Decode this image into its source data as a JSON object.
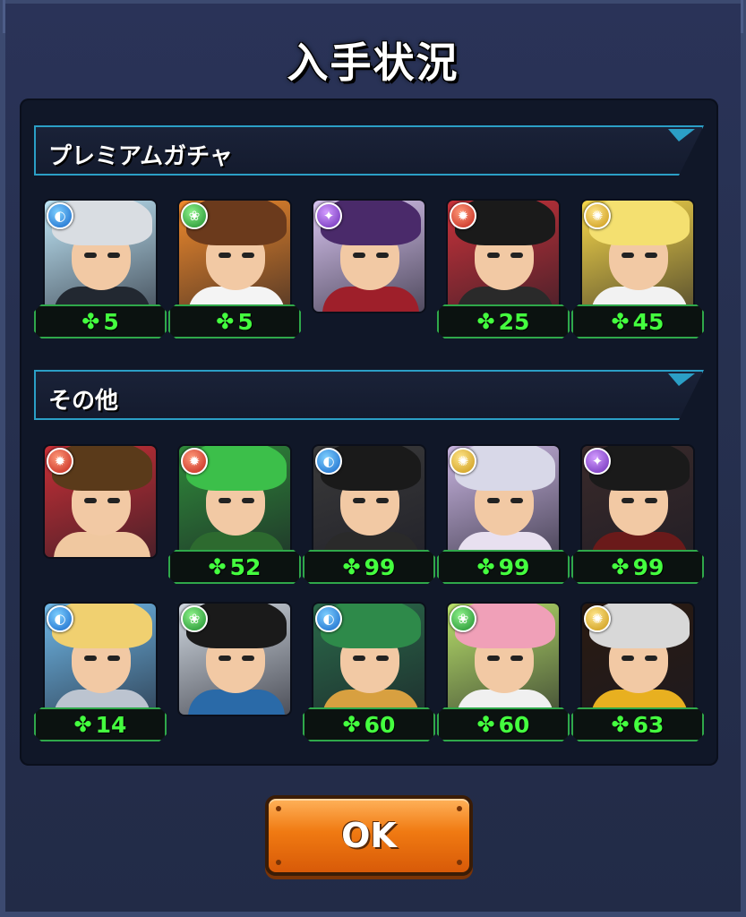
{
  "dialog": {
    "title": "入手状況"
  },
  "sections": [
    {
      "label": "プレミアムガチャ",
      "items": [
        {
          "attribute": "water",
          "count": "5",
          "colors": {
            "bg": "#bfe6f7",
            "hair": "#d9dde2",
            "body": "#222831"
          }
        },
        {
          "attribute": "wood",
          "count": "5",
          "colors": {
            "bg": "#f08a2c",
            "hair": "#6b3a1c",
            "body": "#f4f4f4"
          }
        },
        {
          "attribute": "dark",
          "count": null,
          "colors": {
            "bg": "#d8c4f0",
            "hair": "#4a2a6a",
            "body": "#9e1f2a"
          }
        },
        {
          "attribute": "fire",
          "count": "25",
          "colors": {
            "bg": "#c9323a",
            "hair": "#1a1a1a",
            "body": "#2a2a2a"
          }
        },
        {
          "attribute": "light",
          "count": "45",
          "colors": {
            "bg": "#f7d84a",
            "hair": "#f4e070",
            "body": "#f2f2f2"
          }
        }
      ]
    },
    {
      "label": "その他",
      "items": [
        {
          "attribute": "fire",
          "count": null,
          "colors": {
            "bg": "#c82f36",
            "hair": "#5a3a1a",
            "body": "#f0c8a0"
          }
        },
        {
          "attribute": "fire",
          "count": "52",
          "colors": {
            "bg": "#2f8a3a",
            "hair": "#3cbf4a",
            "body": "#2d6a2f"
          }
        },
        {
          "attribute": "water",
          "count": "99",
          "colors": {
            "bg": "#3a3a3a",
            "hair": "#1a1a1a",
            "body": "#2a2a2a"
          }
        },
        {
          "attribute": "light",
          "count": "99",
          "colors": {
            "bg": "#c8b4e0",
            "hair": "#d8d8e8",
            "body": "#e8e0f0"
          }
        },
        {
          "attribute": "dark",
          "count": "99",
          "colors": {
            "bg": "#3a2a2a",
            "hair": "#1a1a1a",
            "body": "#6a1a1a"
          }
        },
        {
          "attribute": "water",
          "count": "14",
          "colors": {
            "bg": "#6fb8e8",
            "hair": "#f0d070",
            "body": "#bcc4d0"
          }
        },
        {
          "attribute": "wood",
          "count": null,
          "colors": {
            "bg": "#d0d8e0",
            "hair": "#1a1a1a",
            "body": "#2a6aa8"
          }
        },
        {
          "attribute": "water",
          "count": "60",
          "colors": {
            "bg": "#2a6a4a",
            "hair": "#2e8a4a",
            "body": "#d8a040"
          }
        },
        {
          "attribute": "wood",
          "count": "60",
          "colors": {
            "bg": "#b8e06a",
            "hair": "#f0a0b8",
            "body": "#f0f0f0"
          }
        },
        {
          "attribute": "light",
          "count": "63",
          "colors": {
            "bg": "#2a1a10",
            "hair": "#d8d8d8",
            "body": "#e8b020"
          }
        }
      ]
    }
  ],
  "clover_icon": "✤",
  "ok_button": {
    "label": "OK"
  },
  "attribute_icons": {
    "water": "◐",
    "wood": "❀",
    "fire": "✹",
    "light": "✺",
    "dark": "✦"
  }
}
